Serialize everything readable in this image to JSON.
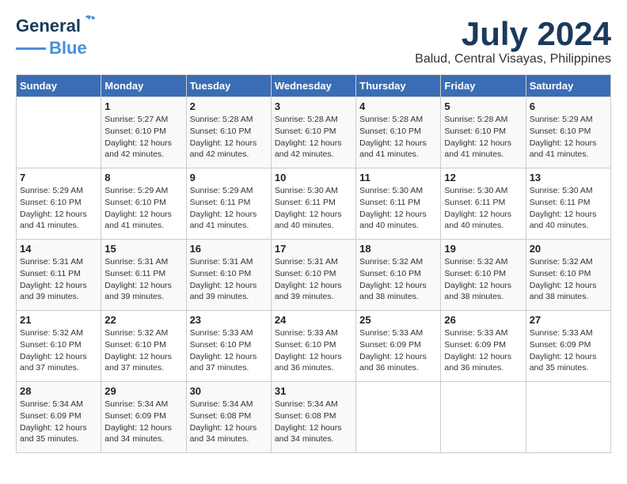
{
  "header": {
    "logo_line1": "General",
    "logo_line2": "Blue",
    "month": "July 2024",
    "location": "Balud, Central Visayas, Philippines"
  },
  "weekdays": [
    "Sunday",
    "Monday",
    "Tuesday",
    "Wednesday",
    "Thursday",
    "Friday",
    "Saturday"
  ],
  "weeks": [
    [
      {
        "day": "",
        "info": ""
      },
      {
        "day": "1",
        "info": "Sunrise: 5:27 AM\nSunset: 6:10 PM\nDaylight: 12 hours\nand 42 minutes."
      },
      {
        "day": "2",
        "info": "Sunrise: 5:28 AM\nSunset: 6:10 PM\nDaylight: 12 hours\nand 42 minutes."
      },
      {
        "day": "3",
        "info": "Sunrise: 5:28 AM\nSunset: 6:10 PM\nDaylight: 12 hours\nand 42 minutes."
      },
      {
        "day": "4",
        "info": "Sunrise: 5:28 AM\nSunset: 6:10 PM\nDaylight: 12 hours\nand 41 minutes."
      },
      {
        "day": "5",
        "info": "Sunrise: 5:28 AM\nSunset: 6:10 PM\nDaylight: 12 hours\nand 41 minutes."
      },
      {
        "day": "6",
        "info": "Sunrise: 5:29 AM\nSunset: 6:10 PM\nDaylight: 12 hours\nand 41 minutes."
      }
    ],
    [
      {
        "day": "7",
        "info": "Sunrise: 5:29 AM\nSunset: 6:10 PM\nDaylight: 12 hours\nand 41 minutes."
      },
      {
        "day": "8",
        "info": "Sunrise: 5:29 AM\nSunset: 6:10 PM\nDaylight: 12 hours\nand 41 minutes."
      },
      {
        "day": "9",
        "info": "Sunrise: 5:29 AM\nSunset: 6:11 PM\nDaylight: 12 hours\nand 41 minutes."
      },
      {
        "day": "10",
        "info": "Sunrise: 5:30 AM\nSunset: 6:11 PM\nDaylight: 12 hours\nand 40 minutes."
      },
      {
        "day": "11",
        "info": "Sunrise: 5:30 AM\nSunset: 6:11 PM\nDaylight: 12 hours\nand 40 minutes."
      },
      {
        "day": "12",
        "info": "Sunrise: 5:30 AM\nSunset: 6:11 PM\nDaylight: 12 hours\nand 40 minutes."
      },
      {
        "day": "13",
        "info": "Sunrise: 5:30 AM\nSunset: 6:11 PM\nDaylight: 12 hours\nand 40 minutes."
      }
    ],
    [
      {
        "day": "14",
        "info": "Sunrise: 5:31 AM\nSunset: 6:11 PM\nDaylight: 12 hours\nand 39 minutes."
      },
      {
        "day": "15",
        "info": "Sunrise: 5:31 AM\nSunset: 6:11 PM\nDaylight: 12 hours\nand 39 minutes."
      },
      {
        "day": "16",
        "info": "Sunrise: 5:31 AM\nSunset: 6:10 PM\nDaylight: 12 hours\nand 39 minutes."
      },
      {
        "day": "17",
        "info": "Sunrise: 5:31 AM\nSunset: 6:10 PM\nDaylight: 12 hours\nand 39 minutes."
      },
      {
        "day": "18",
        "info": "Sunrise: 5:32 AM\nSunset: 6:10 PM\nDaylight: 12 hours\nand 38 minutes."
      },
      {
        "day": "19",
        "info": "Sunrise: 5:32 AM\nSunset: 6:10 PM\nDaylight: 12 hours\nand 38 minutes."
      },
      {
        "day": "20",
        "info": "Sunrise: 5:32 AM\nSunset: 6:10 PM\nDaylight: 12 hours\nand 38 minutes."
      }
    ],
    [
      {
        "day": "21",
        "info": "Sunrise: 5:32 AM\nSunset: 6:10 PM\nDaylight: 12 hours\nand 37 minutes."
      },
      {
        "day": "22",
        "info": "Sunrise: 5:32 AM\nSunset: 6:10 PM\nDaylight: 12 hours\nand 37 minutes."
      },
      {
        "day": "23",
        "info": "Sunrise: 5:33 AM\nSunset: 6:10 PM\nDaylight: 12 hours\nand 37 minutes."
      },
      {
        "day": "24",
        "info": "Sunrise: 5:33 AM\nSunset: 6:10 PM\nDaylight: 12 hours\nand 36 minutes."
      },
      {
        "day": "25",
        "info": "Sunrise: 5:33 AM\nSunset: 6:09 PM\nDaylight: 12 hours\nand 36 minutes."
      },
      {
        "day": "26",
        "info": "Sunrise: 5:33 AM\nSunset: 6:09 PM\nDaylight: 12 hours\nand 36 minutes."
      },
      {
        "day": "27",
        "info": "Sunrise: 5:33 AM\nSunset: 6:09 PM\nDaylight: 12 hours\nand 35 minutes."
      }
    ],
    [
      {
        "day": "28",
        "info": "Sunrise: 5:34 AM\nSunset: 6:09 PM\nDaylight: 12 hours\nand 35 minutes."
      },
      {
        "day": "29",
        "info": "Sunrise: 5:34 AM\nSunset: 6:09 PM\nDaylight: 12 hours\nand 34 minutes."
      },
      {
        "day": "30",
        "info": "Sunrise: 5:34 AM\nSunset: 6:08 PM\nDaylight: 12 hours\nand 34 minutes."
      },
      {
        "day": "31",
        "info": "Sunrise: 5:34 AM\nSunset: 6:08 PM\nDaylight: 12 hours\nand 34 minutes."
      },
      {
        "day": "",
        "info": ""
      },
      {
        "day": "",
        "info": ""
      },
      {
        "day": "",
        "info": ""
      }
    ]
  ]
}
